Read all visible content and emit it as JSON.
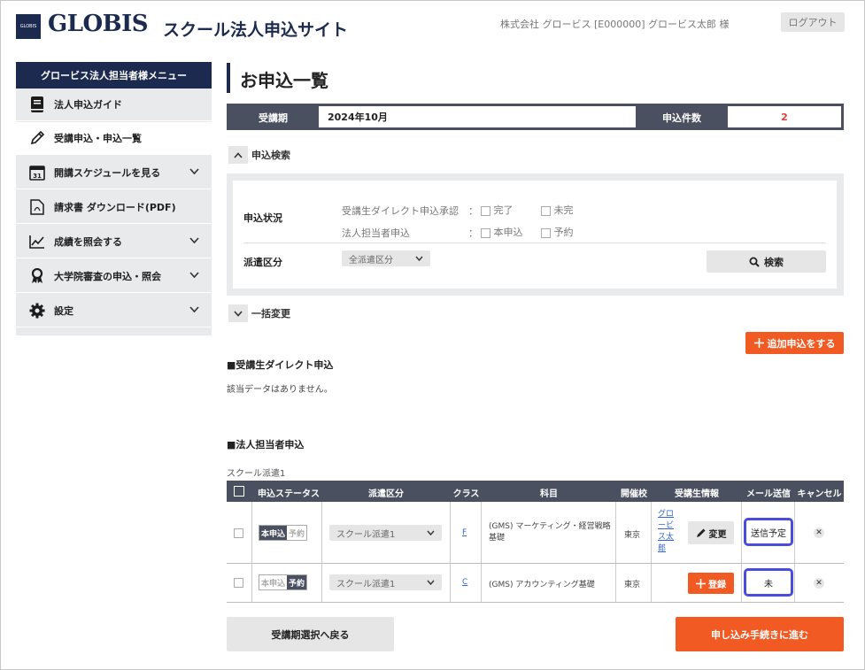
{
  "header": {
    "logo_small": "GLOBIS",
    "logo": "GLOBIS",
    "site_title": "スクール法人申込サイト",
    "company_line": "株式会社 グロービス [E000000] グロービス太郎 様",
    "logout_label": "ログアウト"
  },
  "sidebar": {
    "title": "グロービス法人担当者様メニュー",
    "items": [
      {
        "label": "法人申込ガイド",
        "icon": "book-icon",
        "chevron": false
      },
      {
        "label": "受講申込・申込一覧",
        "icon": "pencil-icon",
        "chevron": false
      },
      {
        "label": "開講スケジュールを見る",
        "icon": "calendar-icon",
        "chevron": true
      },
      {
        "label": "請求書 ダウンロード(PDF)",
        "icon": "pdf-icon",
        "chevron": false
      },
      {
        "label": "成績を照会する",
        "icon": "chart-line-icon",
        "chevron": true
      },
      {
        "label": "大学院審査の申込・照会",
        "icon": "award-icon",
        "chevron": true
      },
      {
        "label": "設定",
        "icon": "gear-icon",
        "chevron": true
      }
    ],
    "calendar_num": "31"
  },
  "main": {
    "title": "お申込一覧",
    "period_label": "受講期",
    "period_value": "2024年10月",
    "count_label": "申込件数",
    "count_value": "2",
    "search_toggle": "申込検索",
    "search": {
      "status_label": "申込状況",
      "direct_label": "受講生ダイレクト申込承認",
      "direct_opt1": "完了",
      "direct_opt2": "未完",
      "corp_label": "法人担当者申込",
      "corp_opt1": "本申込",
      "corp_opt2": "予約",
      "colon": "：",
      "dispatch_label": "派遣区分",
      "dispatch_select": "全派遣区分",
      "search_button": "検索"
    },
    "bulk_toggle": "一括変更",
    "add_button": "追加申込をする",
    "direct_section": "■受講生ダイレクト申込",
    "no_data": "該当データはありません。",
    "corp_section": "■法人担当者申込",
    "school_label": "スクール派遣1",
    "table": {
      "headers": [
        "申込ステータス",
        "派遣区分",
        "クラス",
        "科目",
        "開催校",
        "受講生情報",
        "メール送信",
        "キャンセル"
      ],
      "rows": [
        {
          "status_a": "本申込",
          "status_b": "予約",
          "active": "a",
          "dispatch": "スクール派遣1",
          "class": "F",
          "subject": "(GMS) マーケティング・経営戦略基礎",
          "school": "東京",
          "student_link": "グロービス太郎",
          "student_button": "変更",
          "mail": "送信予定"
        },
        {
          "status_a": "本申込",
          "status_b": "予約",
          "active": "b",
          "dispatch": "スクール派遣1",
          "class": "C",
          "subject": "(GMS) アカウンティング基礎",
          "school": "東京",
          "student_link": "",
          "student_button": "登録",
          "mail": "未"
        }
      ]
    },
    "back_button": "受講期選択へ戻る",
    "proceed_button": "申し込み手続きに進む"
  },
  "colors": {
    "navy": "#1c2a4f",
    "orange": "#f15a22",
    "highlight": "#4a4cdb",
    "count_red": "#e04040"
  }
}
